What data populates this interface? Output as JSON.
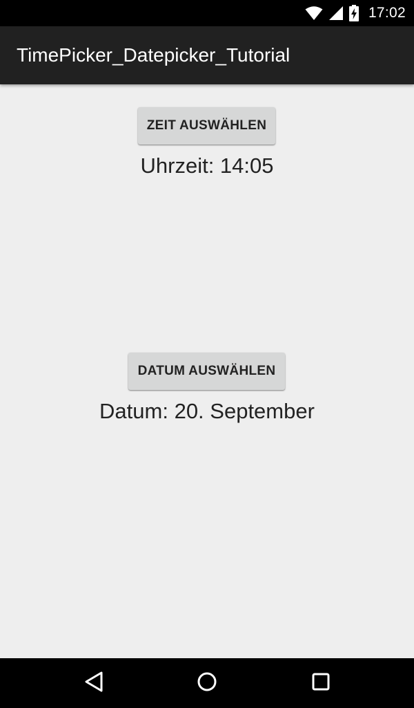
{
  "status_bar": {
    "time": "17:02",
    "icons": [
      "wifi-icon",
      "signal-icon",
      "battery-charging-icon"
    ]
  },
  "action_bar": {
    "title": "TimePicker_Datepicker_Tutorial"
  },
  "time_section": {
    "button_label": "ZEIT AUSWÄHLEN",
    "value_text": "Uhrzeit: 14:05"
  },
  "date_section": {
    "button_label": "DATUM AUSWÄHLEN",
    "value_text": "Datum: 20. September"
  },
  "nav_bar": {
    "buttons": [
      "back-icon",
      "home-icon",
      "recent-apps-icon"
    ]
  },
  "colors": {
    "status_bar_bg": "#000000",
    "action_bar_bg": "#212121",
    "content_bg": "#eeeeee",
    "button_bg": "#d6d7d7",
    "text": "#222222"
  }
}
